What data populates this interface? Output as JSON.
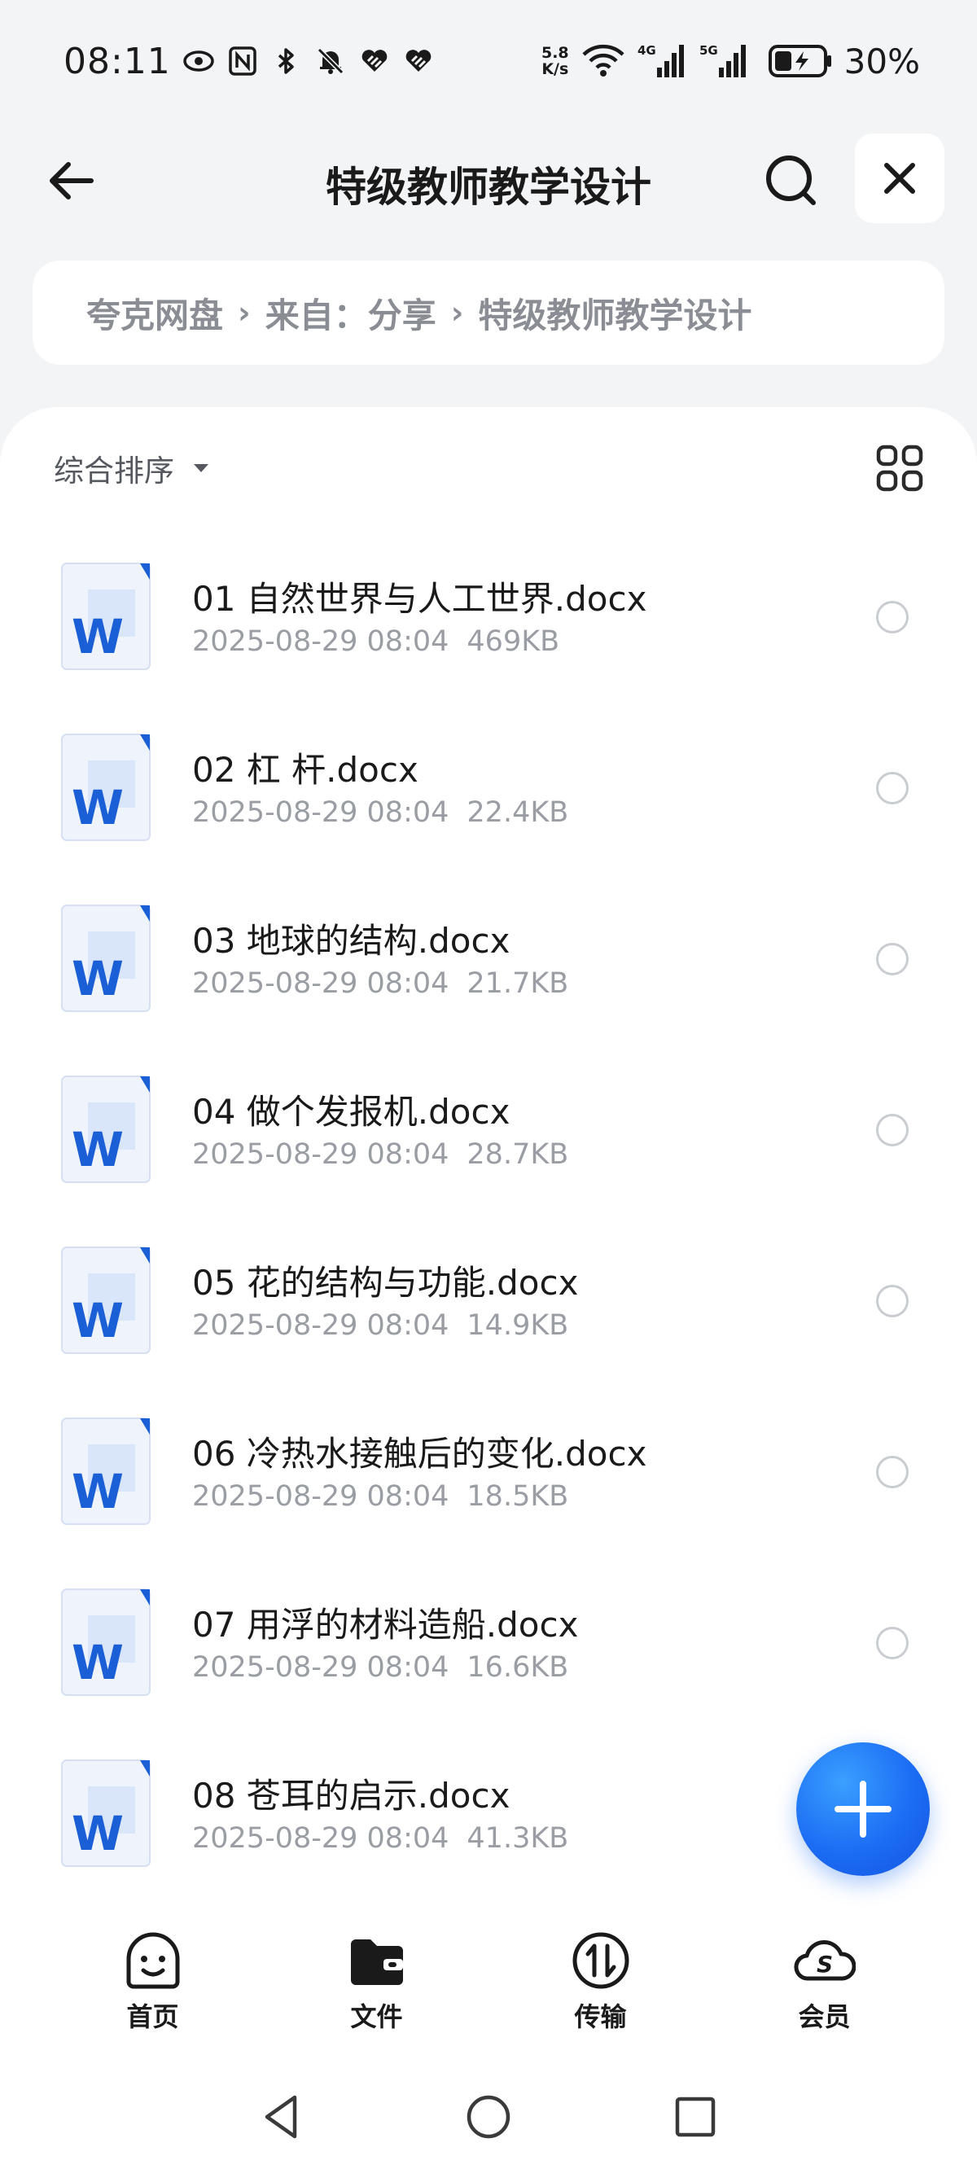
{
  "status_bar": {
    "time": "08:11",
    "net_speed_value": "5.8",
    "net_speed_unit": "K/s",
    "signal_1": "4G",
    "signal_2": "5G",
    "battery": "30%"
  },
  "header": {
    "title": "特级教师教学设计"
  },
  "breadcrumb": {
    "items": [
      "夸克网盘",
      "来自：分享",
      "特级教师教学设计"
    ]
  },
  "sort": {
    "label": "综合排序"
  },
  "files": [
    {
      "name": "01  自然世界与人工世界.docx",
      "date": "2025-08-29 08:04",
      "size": "469KB"
    },
    {
      "name": "02  杠 杆.docx",
      "date": "2025-08-29 08:04",
      "size": "22.4KB"
    },
    {
      "name": "03  地球的结构.docx",
      "date": "2025-08-29 08:04",
      "size": "21.7KB"
    },
    {
      "name": "04  做个发报机.docx",
      "date": "2025-08-29 08:04",
      "size": "28.7KB"
    },
    {
      "name": "05  花的结构与功能.docx",
      "date": "2025-08-29 08:04",
      "size": "14.9KB"
    },
    {
      "name": "06  冷热水接触后的变化.docx",
      "date": "2025-08-29 08:04",
      "size": "18.5KB"
    },
    {
      "name": "07  用浮的材料造船.docx",
      "date": "2025-08-29 08:04",
      "size": "16.6KB"
    },
    {
      "name": "08  苍耳的启示.docx",
      "date": "2025-08-29 08:04",
      "size": "41.3KB"
    }
  ],
  "bottom_nav": {
    "home": "首页",
    "files": "文件",
    "transfer": "传输",
    "member": "会员"
  },
  "colors": {
    "accent": "#1c6cf4",
    "word_blue": "#1a5fd6"
  }
}
